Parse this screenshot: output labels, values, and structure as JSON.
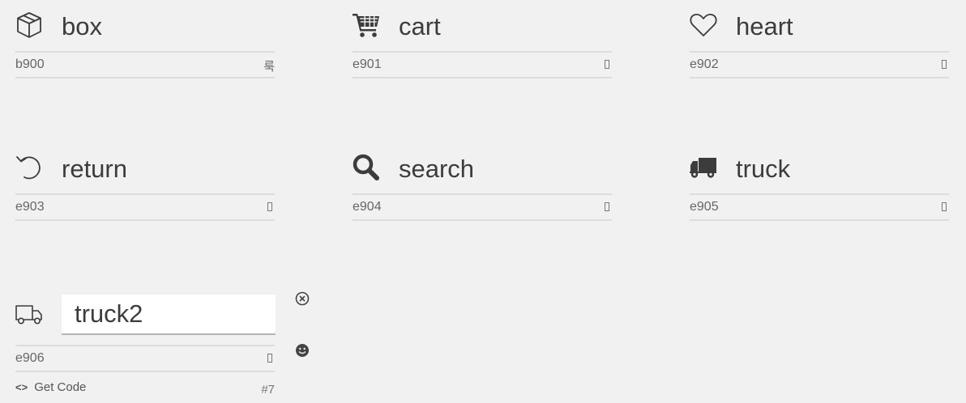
{
  "glyphs": [
    {
      "name": "box",
      "code": "b900",
      "char": "룩",
      "icon": "box-icon"
    },
    {
      "name": "cart",
      "code": "e901",
      "char": "",
      "icon": "cart-icon"
    },
    {
      "name": "heart",
      "code": "e902",
      "char": "",
      "icon": "heart-icon"
    },
    {
      "name": "return",
      "code": "e903",
      "char": "",
      "icon": "return-icon"
    },
    {
      "name": "search",
      "code": "e904",
      "char": "",
      "icon": "search-icon"
    },
    {
      "name": "truck",
      "code": "e905",
      "char": "",
      "icon": "truck-icon"
    },
    {
      "name": "truck2",
      "code": "e906",
      "char": "",
      "icon": "truck-outline-icon"
    }
  ],
  "editor": {
    "get_code_label": "Get Code",
    "index_label": "#7",
    "remove_icon": "circle-x-icon",
    "emoji_icon": "smiley-icon"
  }
}
